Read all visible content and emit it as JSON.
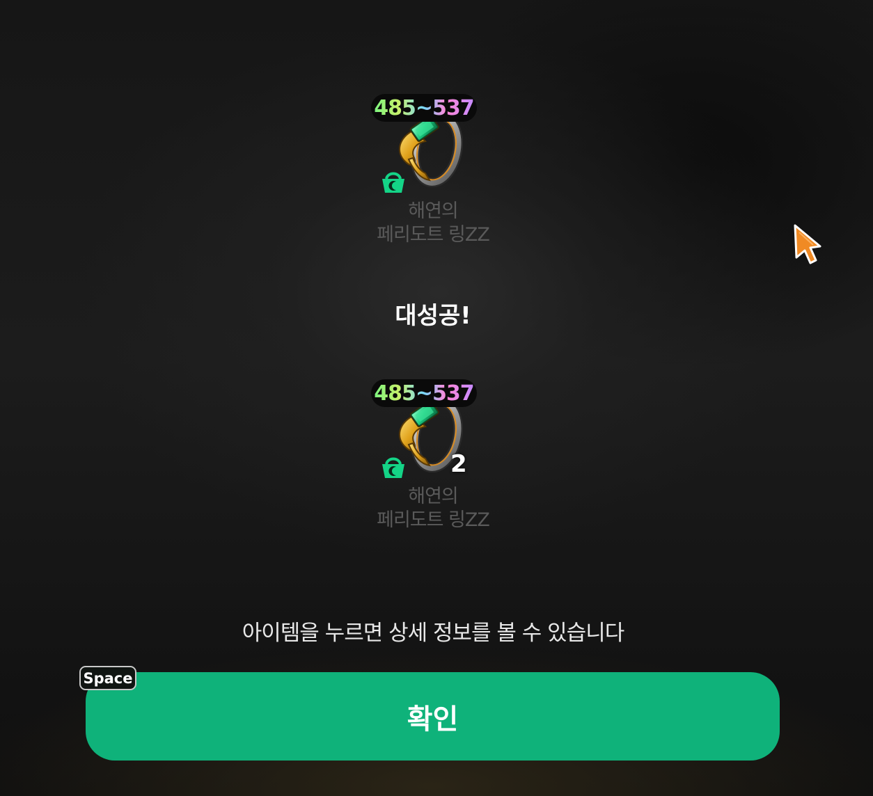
{
  "items": [
    {
      "range": "485~537",
      "name_line1": "해연의",
      "name_line2": "페리도트 링ZZ",
      "quantity": "",
      "icon": "peridot-ring-icon",
      "tag_icon": "basket-icon"
    },
    {
      "range": "485~537",
      "name_line1": "해연의",
      "name_line2": "페리도트 링ZZ",
      "quantity": "2",
      "icon": "peridot-ring-icon",
      "tag_icon": "basket-icon"
    }
  ],
  "result": {
    "title": "대성공!"
  },
  "hint": "아이템을 누르면 상세 정보를 볼 수 있습니다",
  "confirm": {
    "label": "확인",
    "key_hint": "Space"
  },
  "colors": {
    "accent": "#0fb27a",
    "item_name": "#5a5a5a",
    "cursor": "#f08a24"
  }
}
